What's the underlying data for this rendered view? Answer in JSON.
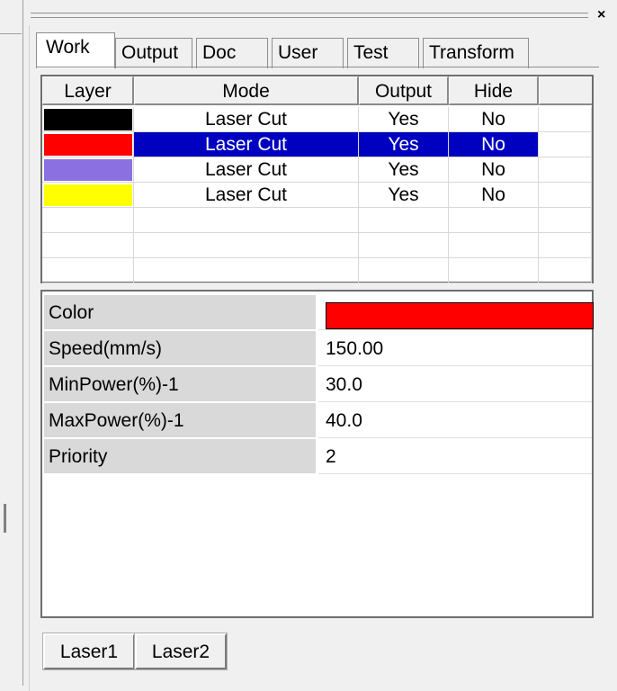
{
  "colors": {
    "selected_bg": "#0000c0",
    "selected_fg": "#ffffff",
    "label_bg": "#d9d9d9"
  },
  "window": {
    "close_glyph": "×"
  },
  "tabs": [
    {
      "label": "Work",
      "active": true
    },
    {
      "label": "Output"
    },
    {
      "label": "Doc"
    },
    {
      "label": "User"
    },
    {
      "label": "Test"
    },
    {
      "label": "Transform"
    }
  ],
  "layer_table": {
    "headers": [
      "Layer",
      "Mode",
      "Output",
      "Hide"
    ],
    "rows": [
      {
        "color": "#000000",
        "mode": "Laser Cut",
        "output": "Yes",
        "hide": "No"
      },
      {
        "color": "#ff0000",
        "mode": "Laser Cut",
        "output": "Yes",
        "hide": "No",
        "selected": true
      },
      {
        "color": "#8a70e0",
        "mode": "Laser Cut",
        "output": "Yes",
        "hide": "No"
      },
      {
        "color": "#ffff00",
        "mode": "Laser Cut",
        "output": "Yes",
        "hide": "No"
      }
    ]
  },
  "properties": {
    "color_label": "Color",
    "color_value": "#ff0000",
    "items": [
      {
        "label": "Speed(mm/s)",
        "value": "150.00"
      },
      {
        "label": "MinPower(%)-1",
        "value": "30.0"
      },
      {
        "label": "MaxPower(%)-1",
        "value": "40.0"
      },
      {
        "label": "Priority",
        "value": "2"
      }
    ]
  },
  "laser_tabs": [
    "Laser1",
    "Laser2"
  ]
}
